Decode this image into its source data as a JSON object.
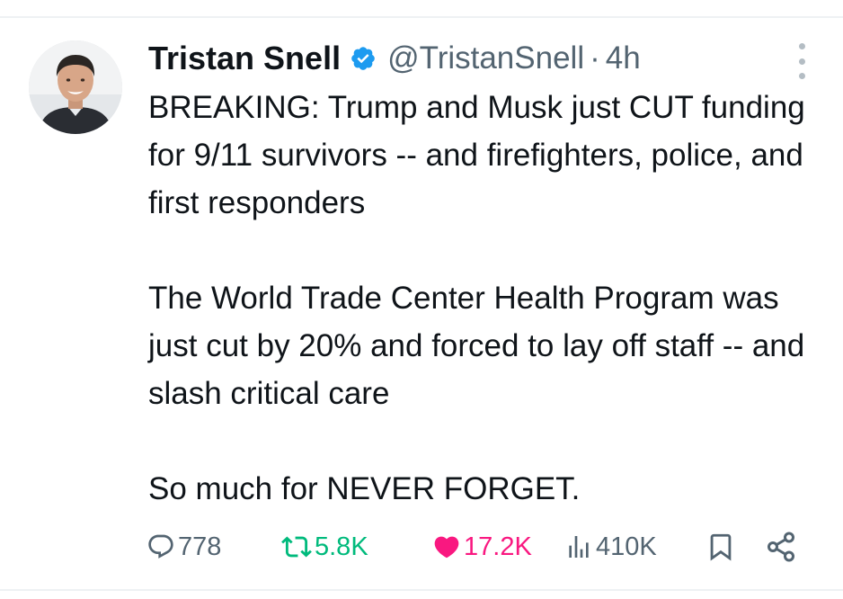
{
  "tweet": {
    "author_name": "Tristan Snell",
    "handle": "@TristanSnell",
    "separator": "·",
    "time": "4h",
    "paragraphs": [
      "BREAKING: Trump and Musk just CUT funding for 9/11 survivors -- and firefighters, police, and first responders",
      "The World Trade Center Health Program was just cut by 20% and forced to lay off staff -- and slash critical care",
      "So much for NEVER FORGET."
    ]
  },
  "actions": {
    "replies": "778",
    "retweets": "5.8K",
    "likes": "17.2K",
    "views": "410K"
  },
  "icons": {
    "verified": "verified-badge-icon",
    "more": "more-vertical-icon",
    "reply": "reply-bubble-icon",
    "retweet": "retweet-icon",
    "like": "heart-icon",
    "views": "views-bar-chart-icon",
    "bookmark": "bookmark-icon",
    "share": "share-icon"
  },
  "colors": {
    "text": "#0f1419",
    "secondary": "#536471",
    "verified": "#1d9bf0",
    "retweet_active": "#00ba7c",
    "like_active": "#f91880"
  }
}
